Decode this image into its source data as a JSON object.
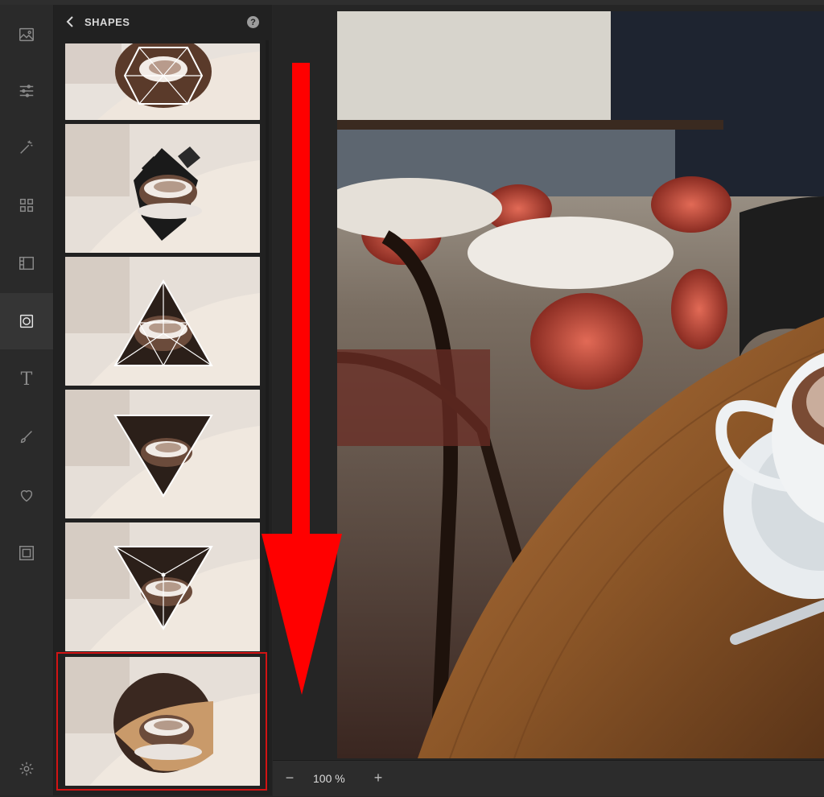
{
  "panel": {
    "title": "SHAPES",
    "help": "?"
  },
  "shape_thumbnails": [
    {
      "shape": "hexagon-lattice"
    },
    {
      "shape": "diamond-cluster"
    },
    {
      "shape": "triangle-up-lattice"
    },
    {
      "shape": "triangle-down-frame"
    },
    {
      "shape": "triangle-down-lattice"
    },
    {
      "shape": "circle",
      "selected": true
    }
  ],
  "zoom": {
    "minus": "−",
    "level": "100 %",
    "plus": "+"
  },
  "rail_icons": [
    "image-icon",
    "adjust-sliders-icon",
    "magic-wand-icon",
    "grid-icon",
    "texture-icon",
    "frame-shape-icon",
    "text-icon",
    "brush-icon",
    "heart-icon",
    "border-icon",
    "gear-icon"
  ],
  "colors": {
    "accent_selection": "#d21414",
    "annotation_arrow": "#ff0000",
    "panel_bg": "#212121",
    "rail_bg": "#2a2a2a"
  }
}
